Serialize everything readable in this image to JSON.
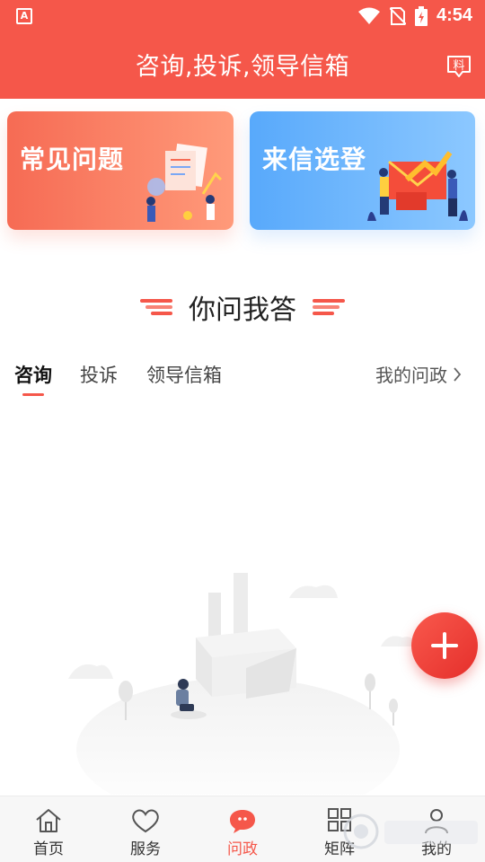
{
  "status_bar": {
    "time": "4:54",
    "app_icon_letter": "A"
  },
  "header": {
    "title": "咨询,投诉,领导信箱",
    "action_icon": "report-icon",
    "action_label": "料"
  },
  "cards": [
    {
      "title": "常见问题",
      "color": "#f66b54"
    },
    {
      "title": "来信选登",
      "color": "#58a9fb"
    }
  ],
  "section": {
    "title": "你问我答"
  },
  "tabs": {
    "items": [
      "咨询",
      "投诉",
      "领导信箱"
    ],
    "active": 0,
    "more_label": "我的问政"
  },
  "fab": {
    "icon": "plus-icon"
  },
  "bottom_nav": {
    "items": [
      {
        "label": "首页",
        "icon": "home-icon"
      },
      {
        "label": "服务",
        "icon": "heart-icon"
      },
      {
        "label": "问政",
        "icon": "chat-bubble-icon"
      },
      {
        "label": "矩阵",
        "icon": "grid-icon"
      },
      {
        "label": "我的",
        "icon": "person-icon"
      }
    ],
    "active": 2
  },
  "colors": {
    "primary": "#f5574a",
    "card_orange": "#f66b54",
    "card_blue": "#58a9fb"
  }
}
